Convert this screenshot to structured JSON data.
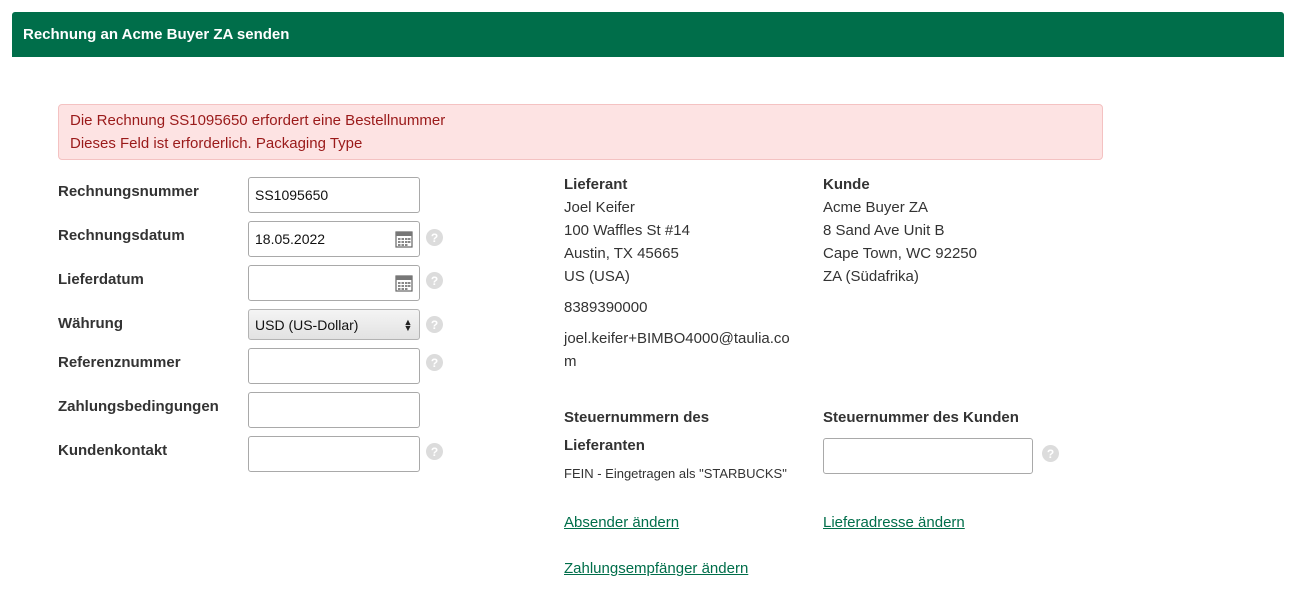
{
  "header": {
    "title": "Rechnung an Acme Buyer ZA senden"
  },
  "alert": {
    "line1": "Die Rechnung SS1095650 erfordert eine Bestellnummer",
    "line2": "Dieses Feld ist erforderlich. Packaging Type"
  },
  "form": {
    "invoice_number": {
      "label": "Rechnungsnummer",
      "value": "SS1095650"
    },
    "invoice_date": {
      "label": "Rechnungsdatum",
      "value": "18.05.2022"
    },
    "delivery_date": {
      "label": "Lieferdatum",
      "value": ""
    },
    "currency": {
      "label": "Währung",
      "value": "USD (US-Dollar)"
    },
    "reference_number": {
      "label": "Referenznummer",
      "value": ""
    },
    "payment_terms": {
      "label": "Zahlungsbedingungen",
      "value": ""
    },
    "customer_contact": {
      "label": "Kundenkontakt",
      "value": ""
    },
    "help_glyph": "?"
  },
  "supplier": {
    "heading": "Lieferant",
    "name": "Joel Keifer",
    "street": "100 Waffles St #14",
    "city": "Austin, TX 45665",
    "country": "US (USA)",
    "phone": "8389390000",
    "email_line1": "joel.keifer+BIMBO4000@taulia.co",
    "email_line2": "m"
  },
  "customer": {
    "heading": "Kunde",
    "name": "Acme Buyer ZA",
    "street": "8 Sand Ave Unit B",
    "city": "Cape Town, WC 92250",
    "country": "ZA (Südafrika)"
  },
  "tax": {
    "supplier_heading_line1": "Steuernummern des",
    "supplier_heading_line2": "Lieferanten",
    "supplier_value": "FEIN - Eingetragen als \"STARBUCKS\"",
    "customer_heading": "Steuernummer des Kunden",
    "customer_value": ""
  },
  "links": {
    "change_sender": "Absender ändern",
    "change_delivery_address": "Lieferadresse ändern",
    "change_payee": "Zahlungsempfänger ändern"
  },
  "colors": {
    "brand": "#006e4a",
    "alert_bg": "#fde3e3",
    "alert_text": "#9a1a1a"
  }
}
